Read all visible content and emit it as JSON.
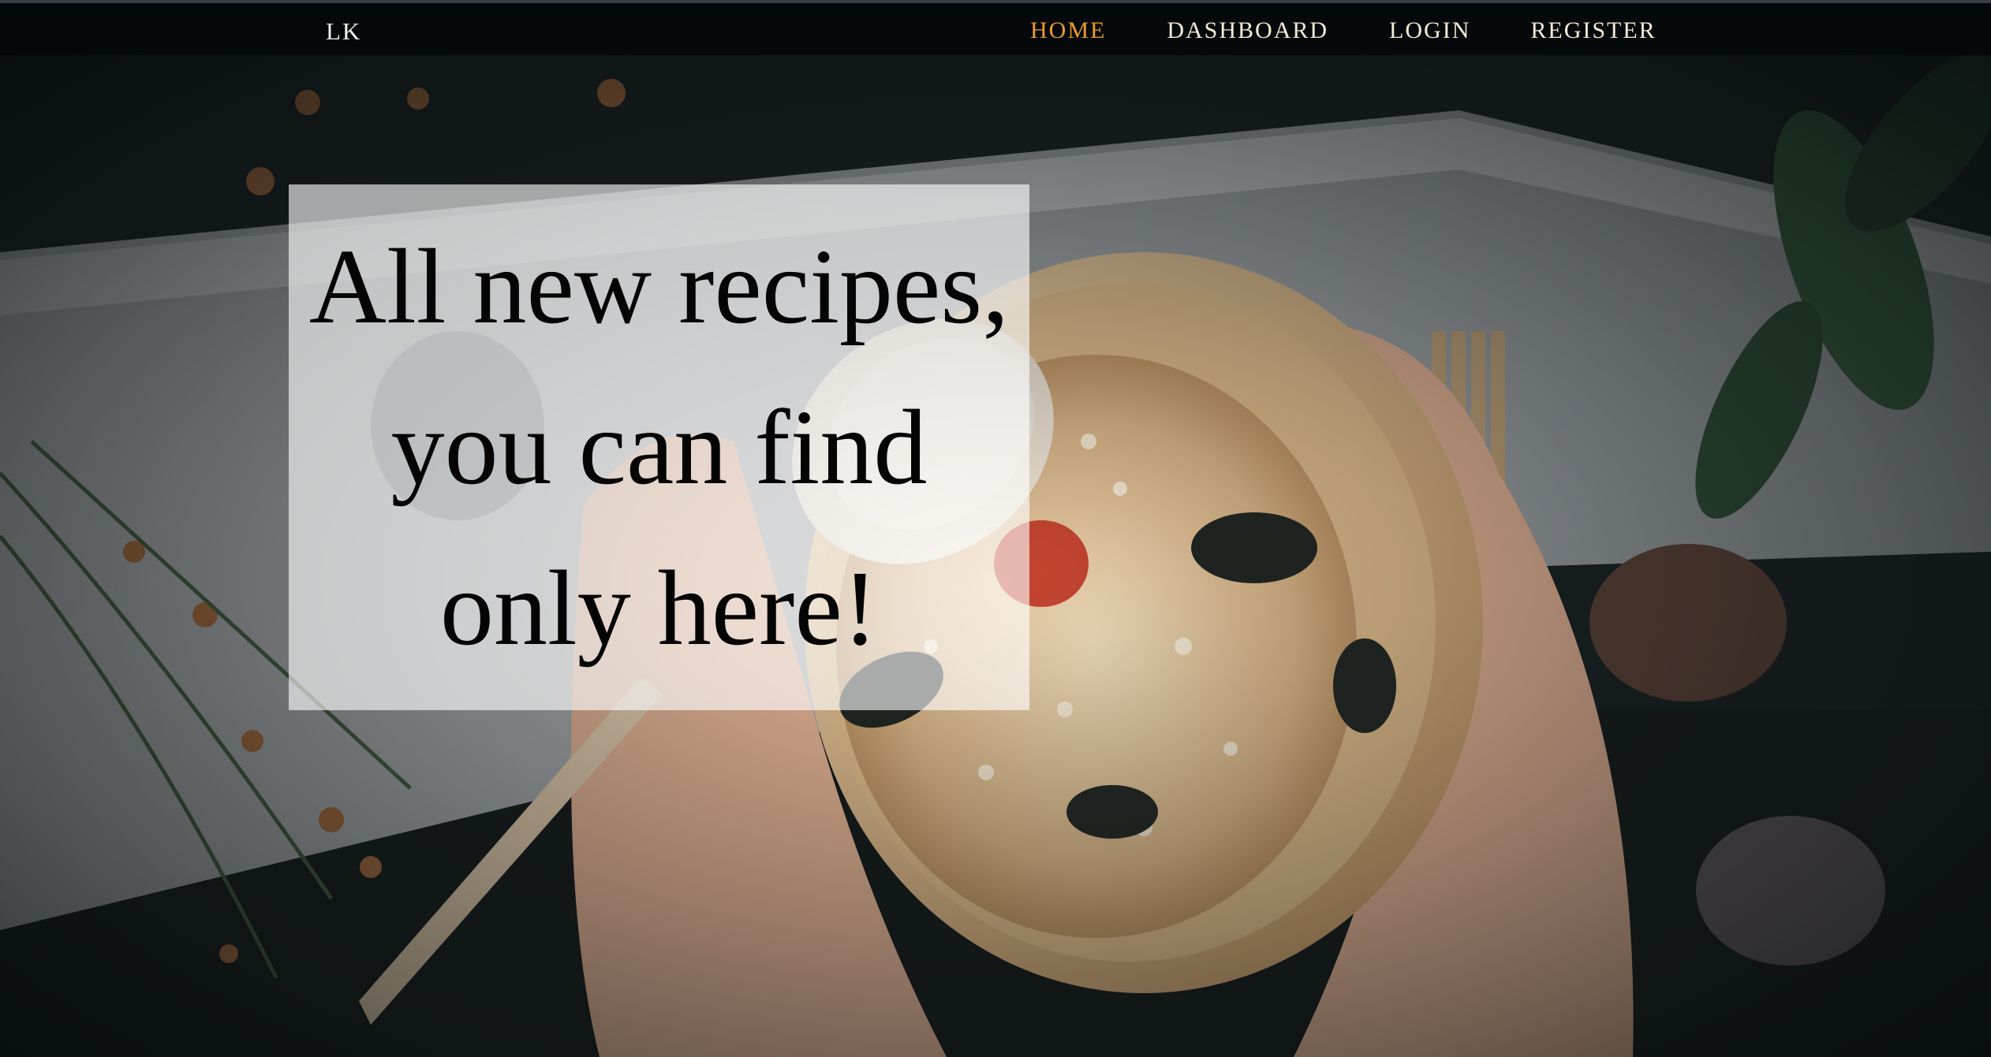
{
  "navbar": {
    "brand": "LK",
    "links": [
      {
        "label": "HOME",
        "active": true
      },
      {
        "label": "DASHBOARD",
        "active": false
      },
      {
        "label": "LOGIN",
        "active": false
      },
      {
        "label": "REGISTER",
        "active": false
      }
    ]
  },
  "hero": {
    "title_lines": [
      "All new recipes,",
      "you can find",
      "only here!"
    ],
    "background_image": "hands-holding-rice-bowl-with-spoon"
  },
  "colors": {
    "nav_active": "#ea9a2c",
    "nav_text": "#f5ead4",
    "navbar_bg": "#04080a",
    "caption_box": "#ffffff",
    "caption_text": "#050505"
  }
}
